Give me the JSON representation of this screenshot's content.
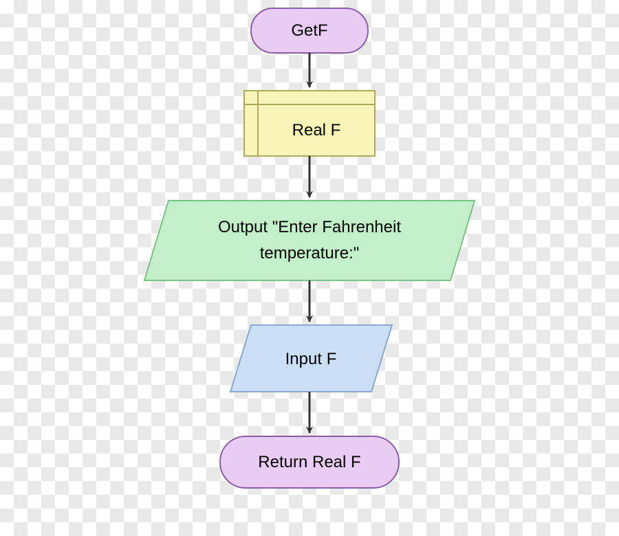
{
  "flowchart": {
    "nodes": {
      "start": {
        "label": "GetF",
        "type": "terminator"
      },
      "declare": {
        "label": "Real F",
        "type": "declaration"
      },
      "output": {
        "line1": "Output \"Enter Fahrenheit",
        "line2": "temperature:\"",
        "type": "io-output"
      },
      "input": {
        "label": "Input F",
        "type": "io-input"
      },
      "return": {
        "label": "Return Real F",
        "type": "terminator"
      }
    },
    "colors": {
      "terminator_fill": "#E9CBF3",
      "terminator_stroke": "#8B5FA8",
      "declaration_fill": "#F7F6B8",
      "declaration_stroke": "#B0A85A",
      "output_fill": "#C3F0C8",
      "output_stroke": "#7FBF88",
      "input_fill": "#CADFF6",
      "input_stroke": "#8AA8D0",
      "arrow": "#333333"
    }
  }
}
